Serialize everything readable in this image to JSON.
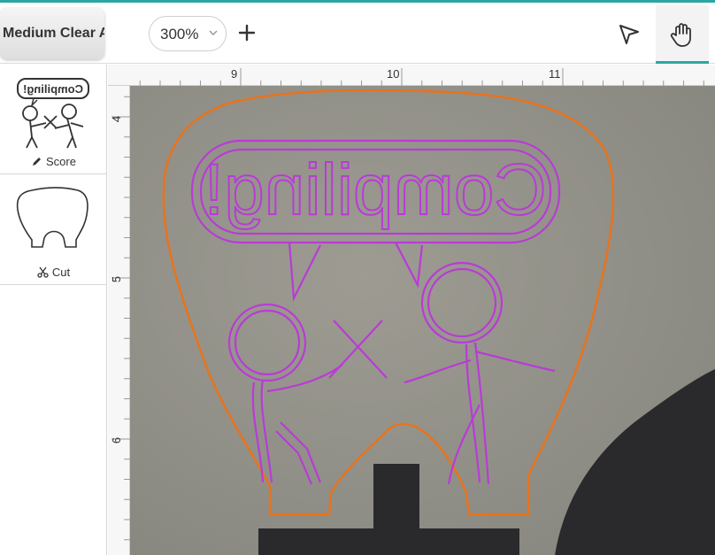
{
  "toolbar": {
    "material_label": "Medium Clear Acrylic",
    "zoom_value": "300%"
  },
  "sidebar": {
    "layers": [
      {
        "operation": "Score",
        "thumb_text": "Compiling!"
      },
      {
        "operation": "Cut"
      }
    ]
  },
  "rulers": {
    "top_labels": [
      "9",
      "10",
      "11"
    ],
    "left_labels": [
      "4",
      "5",
      "6"
    ]
  },
  "design": {
    "bubble_text": "Compiling!",
    "score_color": "#b93bd6",
    "cut_color": "#e8731c"
  },
  "colors": {
    "accent": "#2aa7a4"
  }
}
